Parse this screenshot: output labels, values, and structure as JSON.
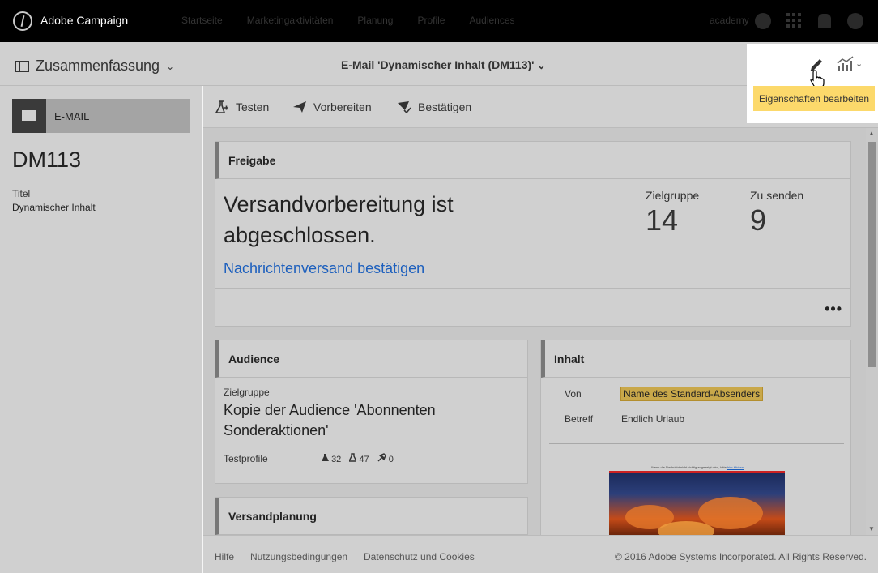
{
  "app": {
    "title": "Adobe Campaign"
  },
  "nav": {
    "items": [
      "Startseite",
      "Marketingaktivitäten",
      "Planung",
      "Profile",
      "Audiences"
    ]
  },
  "user": {
    "name": "academy"
  },
  "subheader": {
    "summary": "Zusammenfassung",
    "title": "E-Mail 'Dynamischer Inhalt (DM113)'"
  },
  "tooltip": {
    "text": "Eigenschaften bearbeiten"
  },
  "sidebar": {
    "type_label": "E-MAIL",
    "code": "DM113",
    "title_label": "Titel",
    "title_value": "Dynamischer Inhalt"
  },
  "actions": {
    "test": "Testen",
    "prepare": "Vorbereiten",
    "confirm": "Bestätigen"
  },
  "freigabe": {
    "heading": "Freigabe",
    "status": "Versandvorbereitung ist abgeschlossen.",
    "link": "Nachrichtenversand bestätigen",
    "target_label": "Zielgruppe",
    "target_value": "14",
    "tosend_label": "Zu senden",
    "tosend_value": "9",
    "more": "•••"
  },
  "audience": {
    "heading": "Audience",
    "target_label": "Zielgruppe",
    "target_value": "Kopie der Audience 'Abonnenten Sonderaktionen'",
    "test_profiles_label": "Testprofile",
    "counts": [
      "32",
      "47",
      "0"
    ]
  },
  "planung": {
    "heading": "Versandplanung"
  },
  "inhalt": {
    "heading": "Inhalt",
    "from_label": "Von",
    "from_value": "Name des Standard-Absenders",
    "subject_label": "Betreff",
    "subject_value": "Endlich Urlaub",
    "preview_text": "Wenn die Nachricht nicht richtig angezeigt wird, bitte",
    "preview_link": "hier klicken"
  },
  "footer": {
    "help": "Hilfe",
    "terms": "Nutzungsbedingungen",
    "privacy": "Datenschutz und Cookies",
    "copyright": "© 2016 Adobe Systems Incorporated. All Rights Reserved."
  }
}
